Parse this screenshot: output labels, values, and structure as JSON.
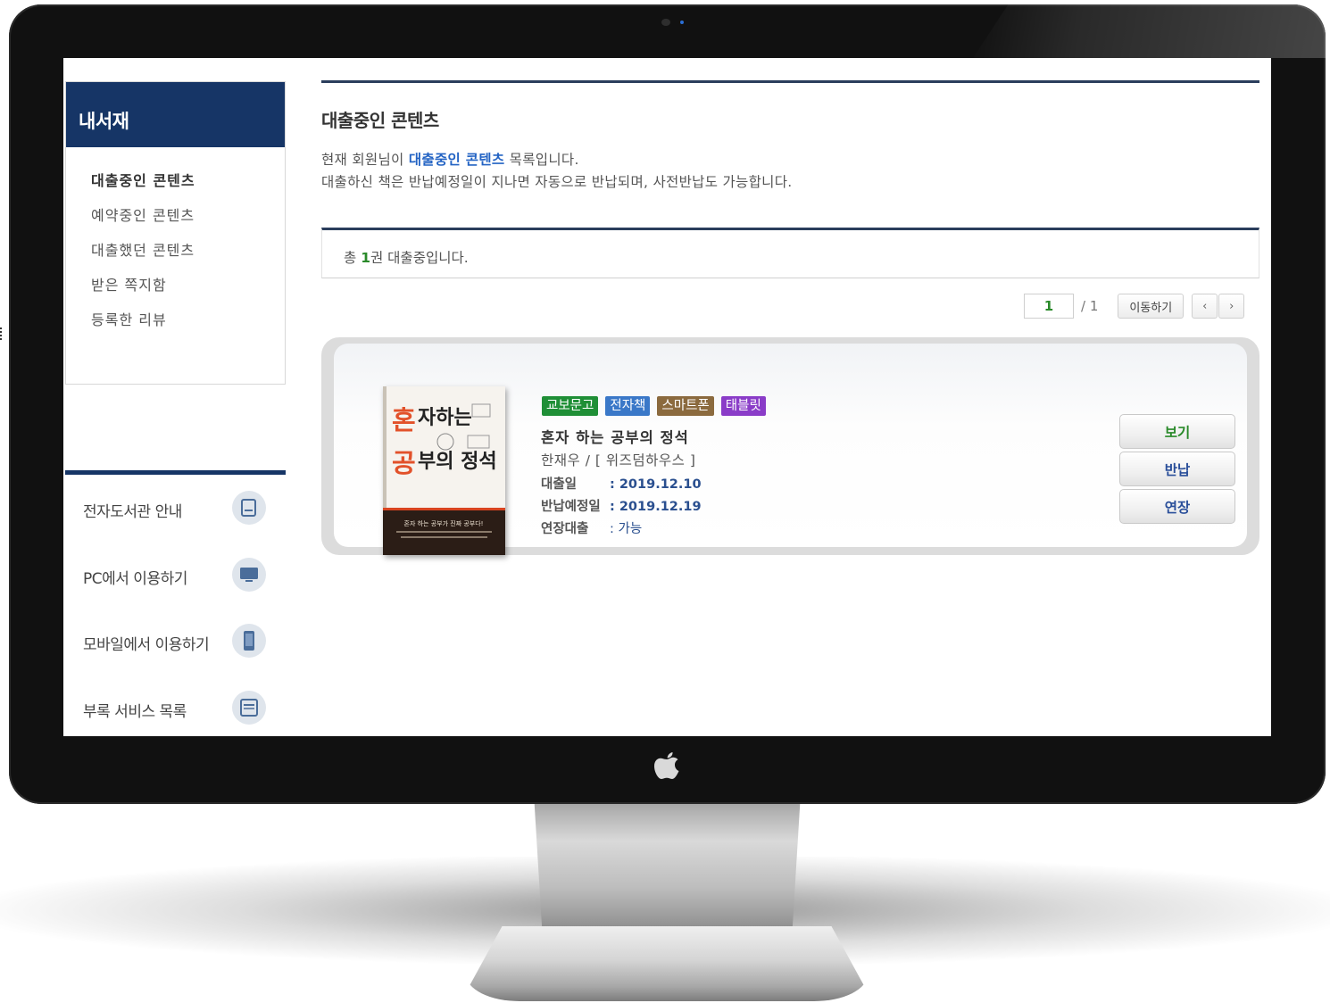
{
  "sidebar": {
    "title": "내서재",
    "menu": [
      {
        "label": "대출중인 콘텐츠",
        "active": true
      },
      {
        "label": "예약중인 콘텐츠",
        "active": false
      },
      {
        "label": "대출했던 콘텐츠",
        "active": false
      },
      {
        "label": "받은 쪽지함",
        "active": false
      },
      {
        "label": "등록한 리뷰",
        "active": false
      }
    ],
    "guide": [
      {
        "label": "전자도서관 안내",
        "icon": "book-icon"
      },
      {
        "label": "PC에서 이용하기",
        "icon": "monitor-icon"
      },
      {
        "label": "모바일에서 이용하기",
        "icon": "mobile-icon"
      },
      {
        "label": "부록 서비스 목록",
        "icon": "list-icon"
      }
    ]
  },
  "main": {
    "title": "대출중인 콘텐츠",
    "desc_line1_prefix": "현재 회원님이 ",
    "desc_line1_highlight": "대출중인 콘텐츠",
    "desc_line1_suffix": " 목록입니다.",
    "desc_line2": "대출하신 책은 반납예정일이 지나면 자동으로 반납되며, 사전반납도 가능합니다.",
    "summary_prefix": "총 ",
    "summary_count": "1",
    "summary_suffix": "권 대출중입니다."
  },
  "pager": {
    "current_page": "1",
    "total_pages": "/ 1",
    "move_label": "이동하기",
    "prev_label": "‹",
    "next_label": "›"
  },
  "book": {
    "tags": [
      {
        "label": "교보문고",
        "color": "#1f8f36"
      },
      {
        "label": "전자책",
        "color": "#3a78c8"
      },
      {
        "label": "스마트폰",
        "color": "#8b6a3e"
      },
      {
        "label": "태블릿",
        "color": "#8a3cc8"
      }
    ],
    "title": "혼자 하는 공부의 정석",
    "author_publisher": "한재우 / [ 위즈덤하우스 ]",
    "loan_date_label": "대출일",
    "loan_date": ": 2019.12.10",
    "due_date_label": "반납예정일",
    "due_date": ": 2019.12.19",
    "extend_label": "연장대출",
    "extend_value": ": 가능",
    "cover": {
      "title_line1": "혼자하는",
      "title_line2": "공부의 정석",
      "tagline": "혼자 하는 공부가 진짜 공부다!"
    },
    "buttons": {
      "view": "보기",
      "return": "반납",
      "extend": "연장"
    }
  },
  "colors": {
    "navy": "#163566",
    "highlight_blue": "#2464c4",
    "count_green": "#2a8a2a"
  }
}
